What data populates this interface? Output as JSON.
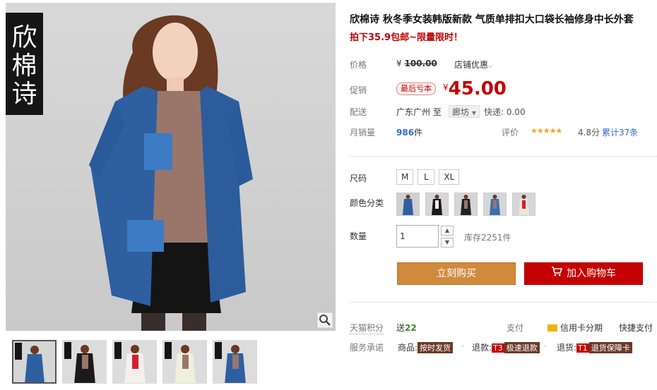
{
  "brand_chars": [
    "欣",
    "棉",
    "诗"
  ],
  "product": {
    "title": "欣棉诗 秋冬季女装韩版新款 气质单排扣大口袋长袖修身中长外套",
    "promo": "拍下35.9包邮~限量限时！"
  },
  "price": {
    "label": "价格",
    "currency": "¥",
    "original": "100.00",
    "shop_discount": "店铺优惠",
    "promo_label": "促销",
    "promo_tag": "最后亏本",
    "current": "45.00"
  },
  "shipping": {
    "label": "配送",
    "from": "广东广州",
    "to_word": "至",
    "destination": "廊坊",
    "express": "快递: 0.00"
  },
  "sales": {
    "label": "月销量",
    "count": "986",
    "unit": "件",
    "rating_label": "评价",
    "stars": "★★★★★",
    "score": "4.8分",
    "reviews": "累计37条"
  },
  "options": {
    "size_label": "尺码",
    "sizes": [
      "M",
      "L",
      "XL"
    ],
    "color_label": "颜色分类",
    "colors": [
      {
        "name": "color-1",
        "swatch": "#2e5fa0"
      },
      {
        "name": "color-2",
        "swatch": "#1a1a1a"
      },
      {
        "name": "color-3",
        "swatch": "#222222"
      },
      {
        "name": "color-4",
        "swatch": "#3b6fb0"
      },
      {
        "name": "color-5",
        "swatch": "#e8e0d0"
      }
    ]
  },
  "quantity": {
    "label": "数量",
    "value": "1",
    "stock": "库存2251件"
  },
  "actions": {
    "buy_now": "立刻购买",
    "add_to_cart": "加入购物车"
  },
  "service": {
    "points_label": "天猫积分",
    "points_prefix": "送",
    "points_value": "22",
    "pay_label": "支付",
    "credit": "信用卡分期",
    "fastpay": "快捷支付",
    "promise_label": "服务承诺",
    "goods_prefix": "商品:",
    "goods_badge": "按时发货",
    "refund_prefix": "退款:",
    "refund_code": "T3",
    "refund_badge": "极速退款",
    "return_prefix": "退货:",
    "return_code": "T1",
    "return_badge": "退货保障卡"
  },
  "colors": {
    "accent_red": "#c40000",
    "buy_orange": "#d08a3c",
    "link_blue": "#3366cc",
    "star_gold": "#f5a623",
    "jacket_blue": "#2e5fa0"
  }
}
